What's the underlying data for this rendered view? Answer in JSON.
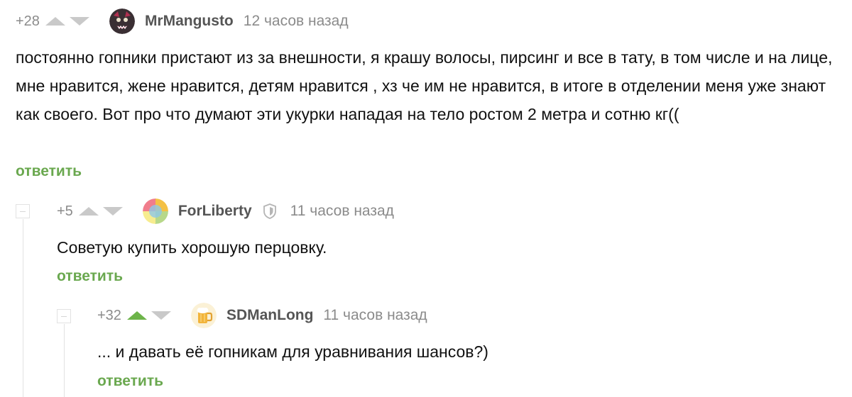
{
  "comments": [
    {
      "rating": "+28",
      "username": "MrMangusto",
      "time": "12 часов назад",
      "text": "постоянно гопники пристают из за внешности, я крашу волосы, пирсинг и все в тату, в том числе и на лице, мне нравится, жене нравится, детям нравится , хз че им не нравится, в итоге в отделении меня уже знают как своего. Вот про что думают эти укурки нападая на тело ростом 2 метра и сотню кг((",
      "reply": "ответить",
      "avatar_icon": "dark-creature-avatar"
    },
    {
      "rating": "+5",
      "username": "ForLiberty",
      "time": "11 часов назад",
      "text": "Советую купить хорошую перцовку.",
      "reply": "ответить",
      "avatar_icon": "colored-circle-avatar",
      "badge_icon": "shield-icon"
    },
    {
      "rating": "+32",
      "username": "SDManLong",
      "time": "11 часов назад",
      "text": "... и давать её гопникам для уравнивания шансов?)",
      "reply": "ответить",
      "avatar_icon": "beer-mug-avatar"
    }
  ],
  "colors": {
    "reply": "#6aa84f",
    "upvote_active": "#6db44a",
    "muted": "#8b8b8b"
  }
}
